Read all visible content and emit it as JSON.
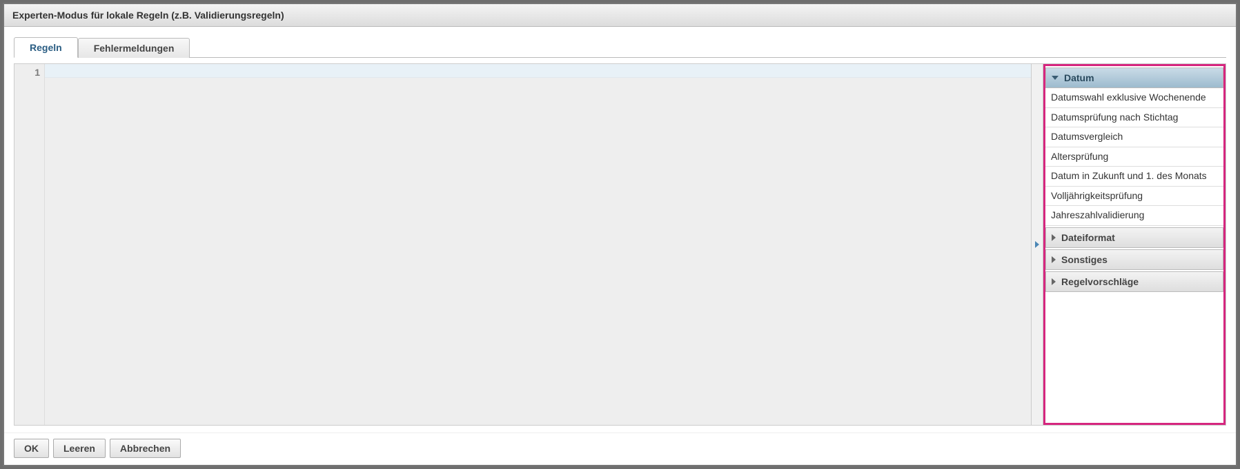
{
  "window": {
    "title": "Experten-Modus für lokale Regeln (z.B. Validierungsregeln)"
  },
  "tabs": {
    "rules": "Regeln",
    "errors": "Fehlermeldungen"
  },
  "editor": {
    "line_numbers": [
      "1"
    ]
  },
  "side": {
    "sections": {
      "datum": {
        "label": "Datum",
        "expanded": true
      },
      "dateiformat": {
        "label": "Dateiformat",
        "expanded": false
      },
      "sonstiges": {
        "label": "Sonstiges",
        "expanded": false
      },
      "vorschlaege": {
        "label": "Regelvorschläge",
        "expanded": false
      }
    },
    "datum_items": [
      "Datumswahl exklusive Wochenende",
      "Datumsprüfung nach Stichtag",
      "Datumsvergleich",
      "Altersprüfung",
      "Datum in Zukunft und 1. des Monats",
      "Volljährigkeitsprüfung",
      "Jahreszahlvalidierung"
    ]
  },
  "buttons": {
    "ok": "OK",
    "clear": "Leeren",
    "cancel": "Abbrechen"
  }
}
